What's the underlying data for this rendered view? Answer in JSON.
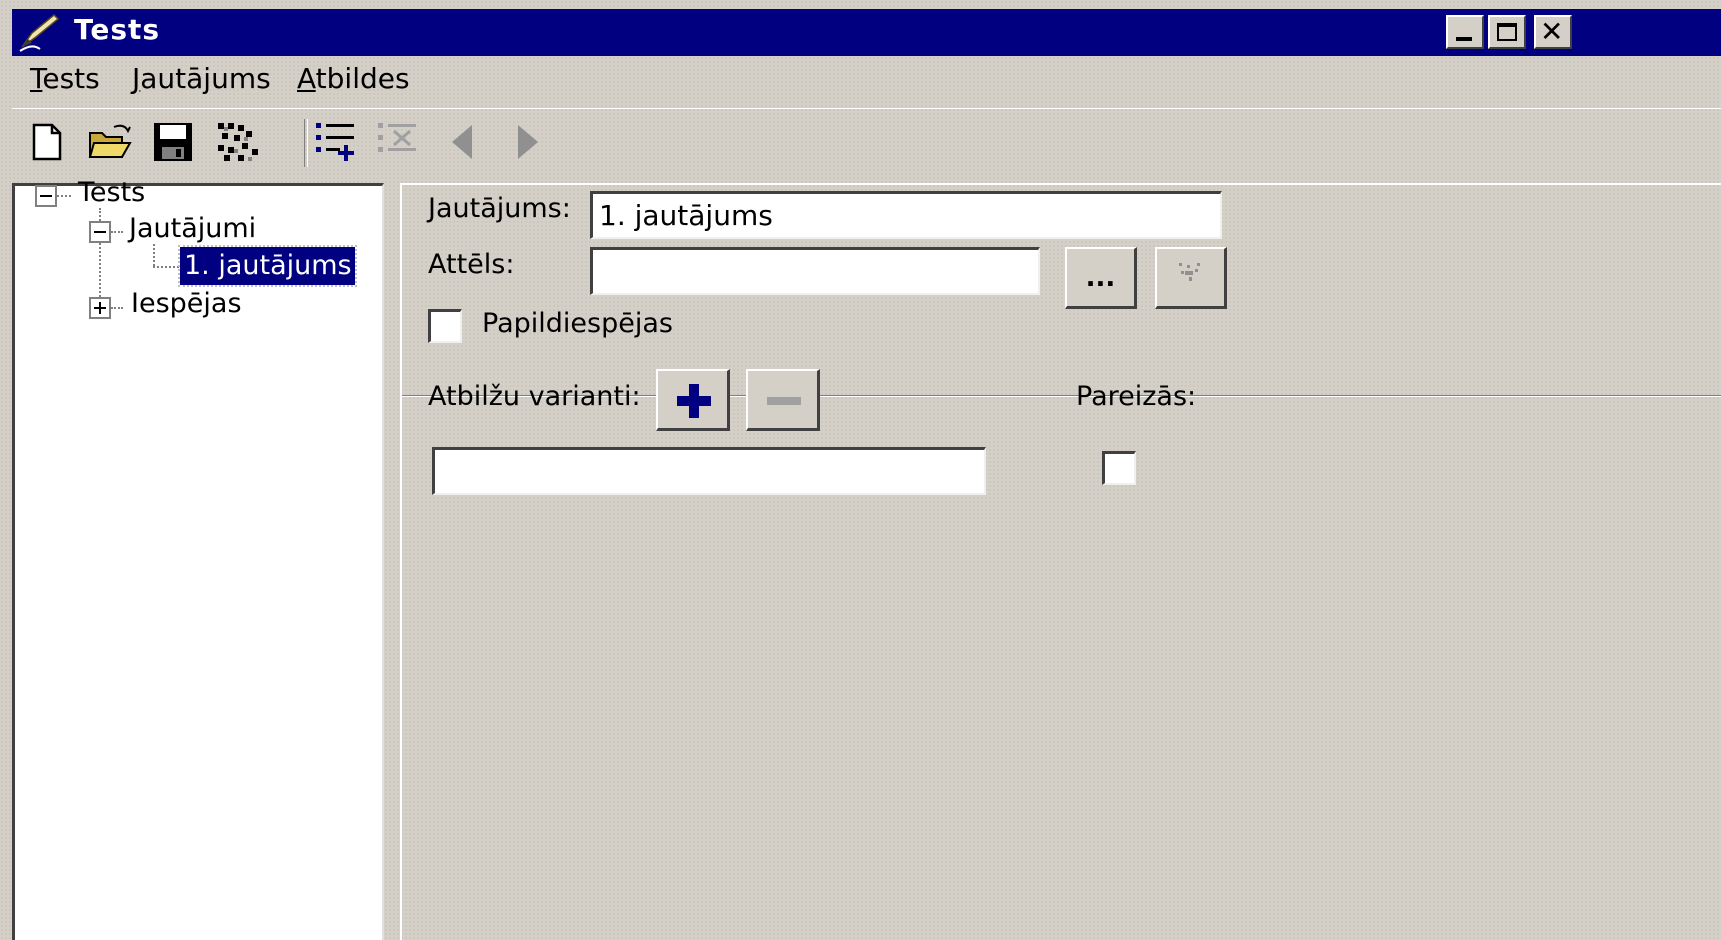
{
  "window": {
    "title": "Tests",
    "title_bar_color": "#000080",
    "icons": {
      "app": "pen-writing-icon",
      "minimize": "minimize-icon",
      "maximize": "maximize-icon",
      "close": "close-icon"
    }
  },
  "menu": {
    "items": [
      {
        "label": "Tests"
      },
      {
        "label": "Jautājums"
      },
      {
        "label": "Atbildes"
      }
    ]
  },
  "toolbar": {
    "buttons": [
      {
        "icon": "new-file-icon",
        "enabled": true
      },
      {
        "icon": "open-folder-icon",
        "enabled": true
      },
      {
        "icon": "save-icon",
        "enabled": true
      },
      {
        "icon": "export-icon",
        "enabled": true
      },
      {
        "icon": "add-item-icon",
        "enabled": true
      },
      {
        "icon": "delete-item-icon",
        "enabled": false
      },
      {
        "icon": "previous-icon",
        "enabled": false
      },
      {
        "icon": "next-icon",
        "enabled": false
      }
    ]
  },
  "tree": {
    "root": {
      "label": "Tests",
      "expanded": true
    },
    "questions": {
      "label": "Jautājumi",
      "expanded": true
    },
    "question_1": {
      "label": "1. jautājums",
      "selected": true
    },
    "options": {
      "label": "Iespējas",
      "expanded": false
    },
    "selection_color": "#000080"
  },
  "form": {
    "question_label": "Jautājums:",
    "question_value": "1. jautājums",
    "image_label": "Attēls:",
    "image_value": "",
    "browse_button_label": "...",
    "clear_image_icon": "clear-image-icon",
    "extra_options_label": "Papildiespējas",
    "extra_options_checked": false,
    "answers_label": "Atbilžu varianti:",
    "add_answer_icon": "plus-icon",
    "remove_answer_icon": "minus-icon",
    "correct_label": "Pareizās:",
    "answers": [
      {
        "text": "",
        "correct": false
      }
    ],
    "accent_color": "#000080"
  }
}
